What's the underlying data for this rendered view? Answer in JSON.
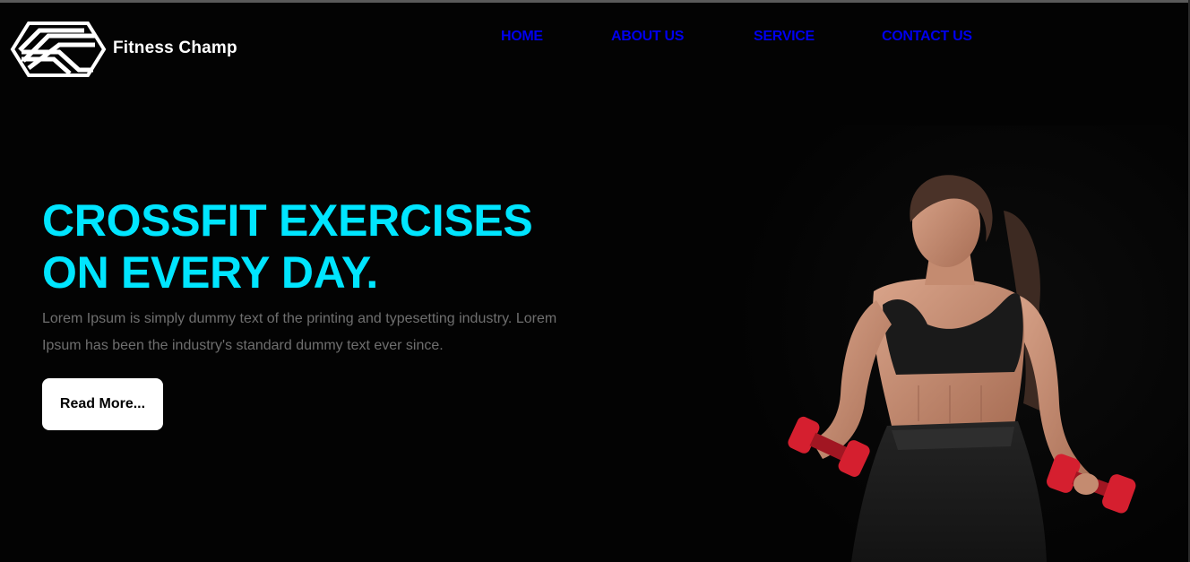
{
  "header": {
    "brand_name": "Fitness Champ",
    "nav": [
      {
        "label": "HOME"
      },
      {
        "label": "ABOUT US"
      },
      {
        "label": "SERVICE"
      },
      {
        "label": "CONTACT US"
      }
    ]
  },
  "hero": {
    "title_line1": "CROSSFIT EXERCISES",
    "title_line2": "ON EVERY DAY.",
    "description": "Lorem Ipsum is simply dummy text of the printing and typesetting industry. Lorem Ipsum has been the industry's standard dummy text ever since.",
    "button_label": "Read More...",
    "image": "woman-athlete-with-red-dumbbells"
  },
  "colors": {
    "background": "#030303",
    "accent": "#00e5ff",
    "nav_link": "#0000ee",
    "text_muted": "#6f6f6f",
    "button_bg": "#ffffff"
  }
}
